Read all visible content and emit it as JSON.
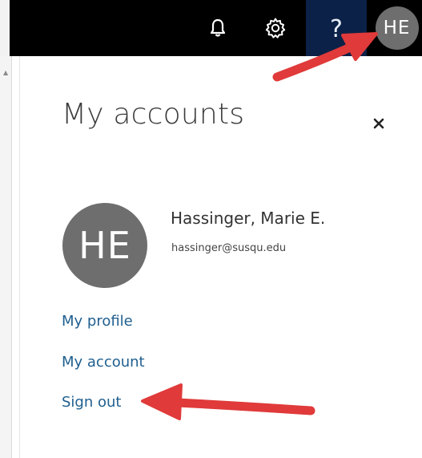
{
  "topbar": {
    "icons": {
      "notifications": "bell-icon",
      "settings": "gear-icon",
      "help": "question-icon"
    },
    "help_glyph": "?",
    "avatar_initials": "HE"
  },
  "panel": {
    "title": "My accounts",
    "close_glyph": "×",
    "user": {
      "initials": "HE",
      "name": "Hassinger, Marie E.",
      "email": "hassinger@susqu.edu"
    },
    "links": {
      "profile": "My profile",
      "account": "My account",
      "sign_out": "Sign out"
    }
  },
  "colors": {
    "topbar": "#000000",
    "help_button": "#0b2147",
    "avatar": "#6e6e6e",
    "link": "#1f5f8f",
    "annotation_arrow": "#e03a3a"
  }
}
